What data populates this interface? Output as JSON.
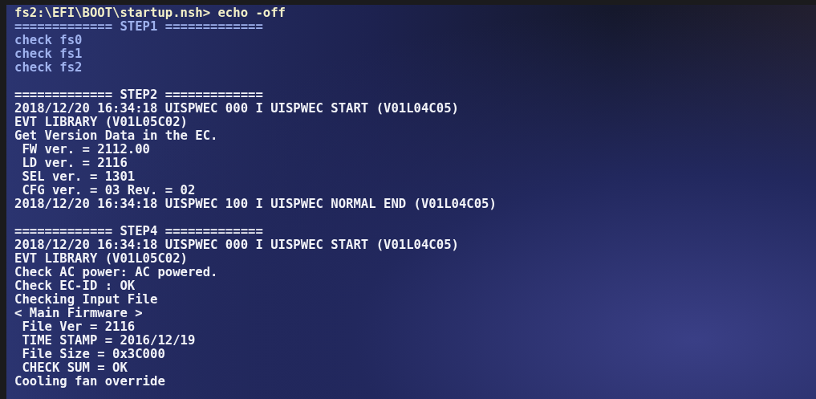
{
  "prompt": "fs2:\\EFI\\BOOT\\startup.nsh> echo -off",
  "blocks": [
    {
      "kind": "dim",
      "lines": [
        "============= STEP1 =============",
        "check fs0",
        "check fs1",
        "check fs2"
      ]
    },
    {
      "kind": "bright",
      "lines": [
        "============= STEP2 =============",
        "2018/12/20 16:34:18 UISPWEC 000 I UISPWEC START (V01L04C05)",
        "EVT LIBRARY (V01L05C02)",
        "Get Version Data in the EC.",
        " FW ver. = 2112.00",
        " LD ver. = 2116",
        " SEL ver. = 1301",
        " CFG ver. = 03 Rev. = 02",
        "2018/12/20 16:34:18 UISPWEC 100 I UISPWEC NORMAL END (V01L04C05)"
      ]
    },
    {
      "kind": "bright",
      "lines": [
        "============= STEP4 =============",
        "2018/12/20 16:34:18 UISPWEC 000 I UISPWEC START (V01L04C05)",
        "EVT LIBRARY (V01L05C02)",
        "Check AC power: AC powered.",
        "Check EC-ID : OK",
        "Checking Input File",
        "< Main Firmware >",
        " File Ver = 2116",
        " TIME STAMP = 2016/12/19",
        " File Size = 0x3C000",
        " CHECK SUM = OK",
        "Cooling fan override"
      ]
    }
  ]
}
